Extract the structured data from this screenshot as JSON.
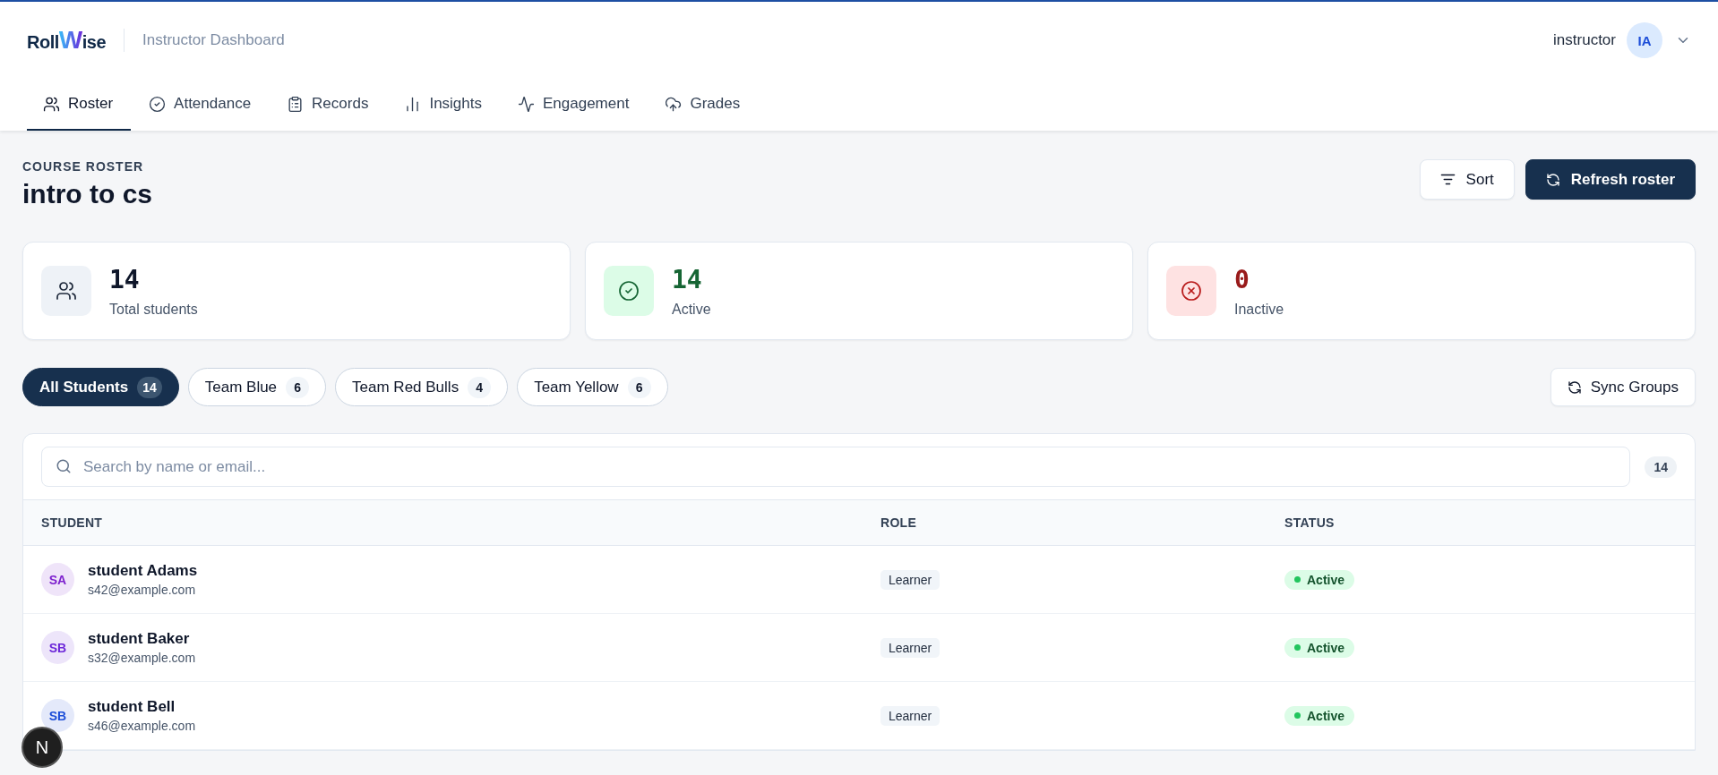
{
  "header": {
    "logo": [
      "Roll",
      "W",
      "ise"
    ],
    "subtitle": "Instructor Dashboard",
    "user": {
      "name": "instructor",
      "initials": "IA"
    }
  },
  "tabs": [
    {
      "label": "Roster",
      "kind": "users",
      "selected": true
    },
    {
      "label": "Attendance",
      "kind": "check",
      "selected": false
    },
    {
      "label": "Records",
      "kind": "clipboard",
      "selected": false
    },
    {
      "label": "Insights",
      "kind": "chart",
      "selected": false
    },
    {
      "label": "Engagement",
      "kind": "activity",
      "selected": false
    },
    {
      "label": "Grades",
      "kind": "upload",
      "selected": false
    }
  ],
  "page": {
    "eyebrow": "COURSE ROSTER",
    "title": "intro to cs",
    "buttons": [
      {
        "label": "Sort",
        "kind": "secondary"
      },
      {
        "label": "Refresh roster",
        "kind": "primary"
      }
    ]
  },
  "stats": [
    {
      "value": "14",
      "label": "Total students",
      "kind": "total"
    },
    {
      "value": "14",
      "label": "Active",
      "kind": "active"
    },
    {
      "value": "0",
      "label": "Inactive",
      "kind": "inactive"
    }
  ],
  "groups": [
    {
      "label": "All Students",
      "count": "14",
      "selected": true
    },
    {
      "label": "Team Blue",
      "count": "6",
      "selected": false
    },
    {
      "label": "Team Red Bulls",
      "count": "4",
      "selected": false
    },
    {
      "label": "Team Yellow",
      "count": "6",
      "selected": false
    }
  ],
  "sync_button": "Sync Groups",
  "table": {
    "search": {
      "placeholder": "Search by name or email..."
    },
    "count": "14",
    "columns": [
      "STUDENT",
      "ROLE",
      "STATUS"
    ],
    "rows": [
      {
        "initials": "SA",
        "color": "#7e22ce",
        "name": "student Adams",
        "email": "s42@example.com",
        "role": "Learner",
        "status": "Active"
      },
      {
        "initials": "SB",
        "color": "#6d28d9",
        "name": "student Baker",
        "email": "s32@example.com",
        "role": "Learner",
        "status": "Active"
      },
      {
        "initials": "SB",
        "color": "#1d4ed8",
        "name": "student Bell",
        "email": "s46@example.com",
        "role": "Learner",
        "status": "Active"
      }
    ]
  },
  "dev_badge": "N"
}
